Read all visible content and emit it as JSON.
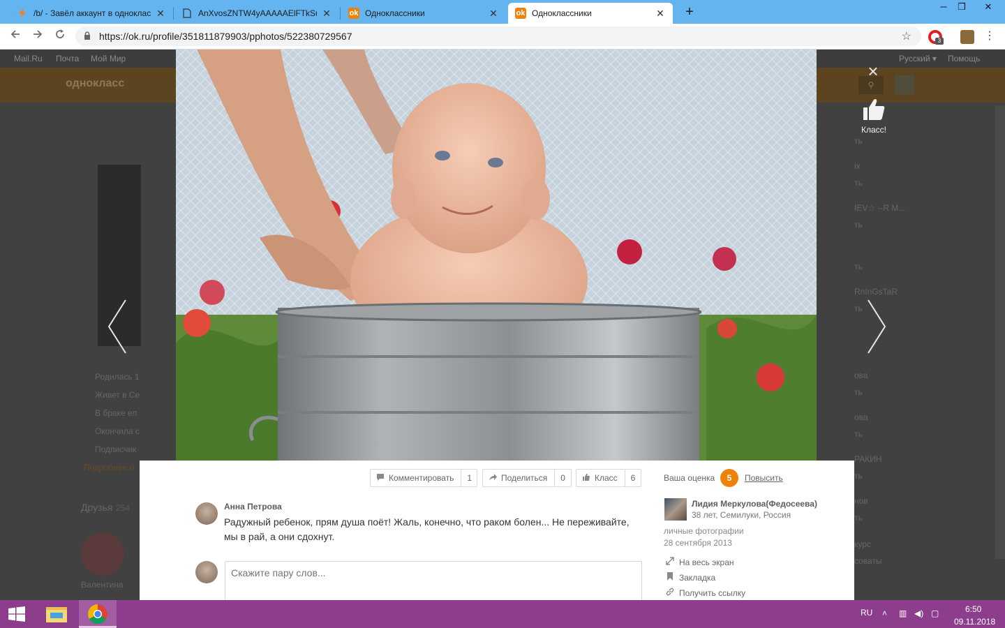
{
  "browser": {
    "tabs": [
      {
        "title": "/b/ - Завёл аккаунт в однокласс",
        "favicon": "lightning-icon",
        "active": false
      },
      {
        "title": "AnXvosZNTW4yAAAAAElFTkSuQ",
        "favicon": "document-icon",
        "active": false
      },
      {
        "title": "Одноклассники",
        "favicon": "ok-icon",
        "active": false
      },
      {
        "title": "Одноклассники",
        "favicon": "ok-icon",
        "active": true
      }
    ],
    "new_tab": "+",
    "url": "https://ok.ru/profile/351811879903/pphotos/522380729567",
    "extension_badge": "3",
    "window_controls": {
      "minimize": "─",
      "maximize": "❐",
      "close": "✕"
    }
  },
  "background_page": {
    "topnav": [
      "Mail.Ru",
      "Почта",
      "Мой Мир"
    ],
    "lang": "Русский ▾",
    "help": "Помощь",
    "logo_text": "однокласс",
    "sidebar_info": [
      "Родилась  1",
      "Живет в Се",
      "В браке ел",
      "Окончила с",
      "Подписчик"
    ],
    "more_link": "Подробнее о",
    "friends_label": "Друзья",
    "friends_count": "254",
    "friend_name": "Валентина",
    "right_feed": [
      "ть",
      "ть",
      "ix",
      "ть",
      "IEV☆ --R M...",
      "ть",
      "ть",
      "RnInGsTaR",
      "ть",
      "ова",
      "ть",
      "ова",
      "ть",
      "РАКИН",
      "ть",
      "нов",
      "ть",
      "курс",
      "соваты"
    ]
  },
  "viewer": {
    "close_icon": "×",
    "class_label": "Класс!",
    "prev_icon": "chevron-left-icon",
    "next_icon": "chevron-right-icon"
  },
  "actions": {
    "comment": {
      "label": "Комментировать",
      "count": "1"
    },
    "share": {
      "label": "Поделиться",
      "count": "0"
    },
    "klass": {
      "label": "Класс",
      "count": "6"
    }
  },
  "rating": {
    "label": "Ваша оценка",
    "value": "5",
    "raise_link": "Повысить"
  },
  "comment": {
    "author": "Анна Петрова",
    "text": "Радужный ребенок, прям душа поёт! Жаль, конечно, что раком болен... Не переживайте, мы в рай, а они сдохнут.",
    "input_placeholder": "Скажите пару слов..."
  },
  "owner": {
    "name": "Лидия Меркулова(Федосеева)",
    "meta": "38 лет, Семилуки, Россия",
    "album": "личные фотографии",
    "date": "28 сентября 2013"
  },
  "side_links": [
    {
      "label": "На весь экран",
      "icon": "expand-icon"
    },
    {
      "label": "Закладка",
      "icon": "bookmark-icon"
    },
    {
      "label": "Получить ссылку",
      "icon": "link-icon"
    }
  ],
  "taskbar": {
    "lang": "RU",
    "time": "6:50",
    "date": "09.11.2018"
  },
  "colors": {
    "ok_orange": "#ee8208",
    "tabstrip": "#64b4f0",
    "taskbar": "#8c3d8c"
  }
}
